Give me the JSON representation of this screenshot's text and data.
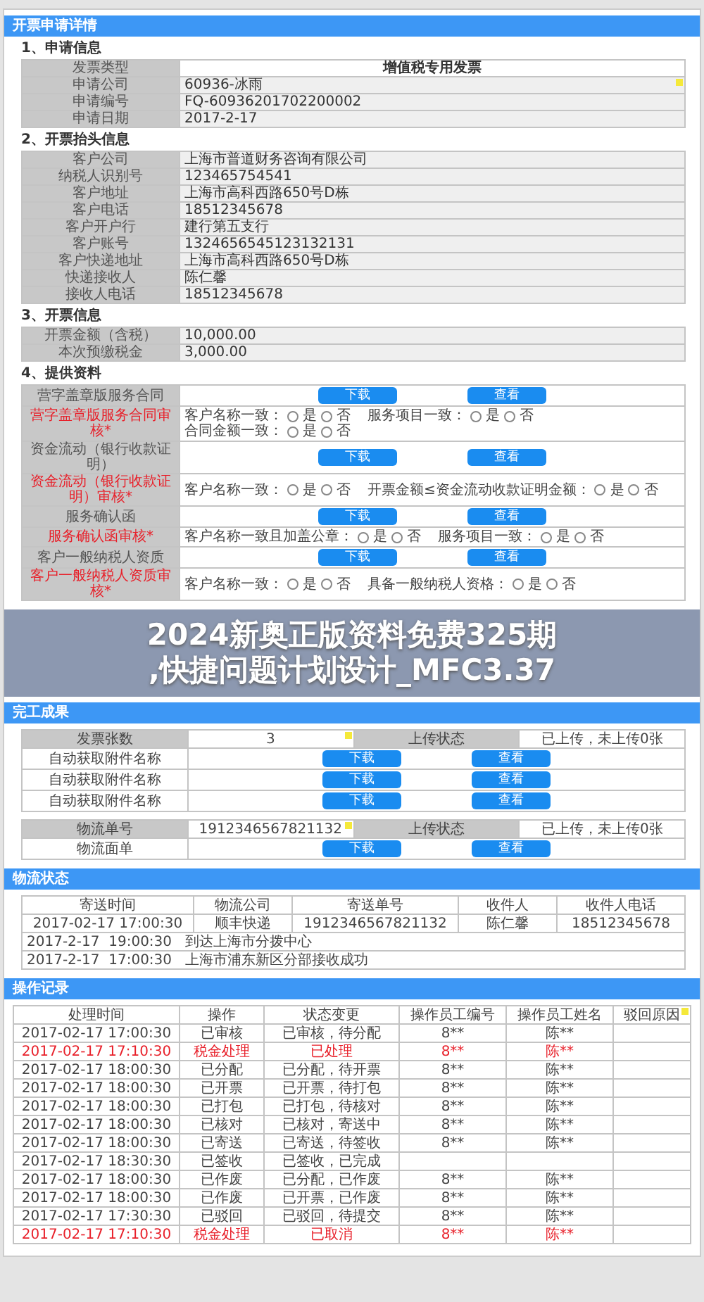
{
  "application": {
    "title": "开票申请详情",
    "request": {
      "heading": "1、申请信息",
      "rows": [
        {
          "kind": "title",
          "label": "发票类型",
          "value": "增值税专用发票",
          "note": false
        },
        {
          "kind": "field",
          "label": "申请公司",
          "value": "60936-冰雨",
          "note": true
        },
        {
          "kind": "field",
          "label": "申请编号",
          "value": "FQ-60936201702200002",
          "note": false
        },
        {
          "kind": "field",
          "label": "申请日期",
          "value": "2017-2-17",
          "note": false
        }
      ]
    },
    "header_info": {
      "heading": "2、开票抬头信息",
      "rows": [
        {
          "kind": "field",
          "label": "客户公司",
          "value": "上海市普道财务咨询有限公司"
        },
        {
          "kind": "field",
          "label": "纳税人识别号",
          "value": "123465754541"
        },
        {
          "kind": "field",
          "label": "客户地址",
          "value": "上海市高科西路650号D栋"
        },
        {
          "kind": "field",
          "label": "客户电话",
          "value": "18512345678"
        },
        {
          "kind": "field",
          "label": "客户开户行",
          "value": "建行第五支行"
        },
        {
          "kind": "field",
          "label": "客户账号",
          "value": "1324656545123132131"
        },
        {
          "kind": "field",
          "label": "客户快递地址",
          "value": "上海市高科西路650号D栋"
        },
        {
          "kind": "field",
          "label": "快递接收人",
          "value": "陈仁馨"
        },
        {
          "kind": "field",
          "label": "接收人电话",
          "value": "18512345678"
        }
      ]
    },
    "invoice_info": {
      "heading": "3、开票信息",
      "rows": [
        {
          "kind": "field",
          "label": "开票金额（含税）",
          "value": "10,000.00"
        },
        {
          "kind": "field",
          "label": "本次预缴税金",
          "value": "3,000.00"
        }
      ]
    },
    "materials": {
      "heading": "4、提供资料",
      "rows": [
        {
          "kind": "file",
          "label": "营字盖章版服务合同",
          "buttons": [
            "下载",
            "查看"
          ]
        },
        {
          "kind": "review",
          "label": "营字盖章版服务合同审核*",
          "questions": [
            {
              "label": "客户名称一致：",
              "options": [
                {
                  "label": "是",
                  "selected": false
                },
                {
                  "label": "否",
                  "selected": false
                }
              ]
            },
            {
              "label": "服务项目一致：",
              "options": [
                {
                  "label": "是",
                  "selected": false
                },
                {
                  "label": "否",
                  "selected": false
                }
              ]
            },
            {
              "label": "合同金额一致：",
              "options": [
                {
                  "label": "是",
                  "selected": false
                },
                {
                  "label": "否",
                  "selected": false
                }
              ]
            }
          ]
        },
        {
          "kind": "file",
          "label": "资金流动（银行收款证明）",
          "buttons": [
            "下载",
            "查看"
          ]
        },
        {
          "kind": "review",
          "label": "资金流动（银行收款证明）审核*",
          "questions": [
            {
              "label": "客户名称一致：",
              "options": [
                {
                  "label": "是",
                  "selected": false
                },
                {
                  "label": "否",
                  "selected": false
                }
              ]
            },
            {
              "label": "开票金额≤资金流动收款证明金额：",
              "options": [
                {
                  "label": "是",
                  "selected": false
                },
                {
                  "label": "否",
                  "selected": false
                }
              ]
            }
          ]
        },
        {
          "kind": "file",
          "label": "服务确认函",
          "buttons": [
            "下载",
            "查看"
          ]
        },
        {
          "kind": "review",
          "label": "服务确认函审核*",
          "questions": [
            {
              "label": "客户名称一致且加盖公章：",
              "options": [
                {
                  "label": "是",
                  "selected": false
                },
                {
                  "label": "否",
                  "selected": false
                }
              ]
            },
            {
              "label": "服务项目一致：",
              "options": [
                {
                  "label": "是",
                  "selected": false
                },
                {
                  "label": "否",
                  "selected": false
                }
              ]
            }
          ]
        },
        {
          "kind": "file",
          "label": "客户一般纳税人资质",
          "buttons": [
            "下载",
            "查看"
          ]
        },
        {
          "kind": "review",
          "label": "客户一般纳税人资质审核*",
          "questions": [
            {
              "label": "客户名称一致：",
              "options": [
                {
                  "label": "是",
                  "selected": false
                },
                {
                  "label": "否",
                  "selected": false
                }
              ]
            },
            {
              "label": "具备一般纳税人资格：",
              "options": [
                {
                  "label": "是",
                  "selected": false
                },
                {
                  "label": "否",
                  "selected": false
                }
              ]
            }
          ]
        }
      ]
    }
  },
  "banner": {
    "lines": [
      "2024新奥正版资料免费325期",
      ",快捷问题计划设计_MFC3.37"
    ]
  },
  "completion": {
    "title": "完工成果",
    "tables": [
      {
        "head": [
          "发票张数",
          "3",
          "上传状态",
          "已上传，未上传0张"
        ],
        "note": true,
        "rows": [
          {
            "label": "自动获取附件名称",
            "buttons": [
              "下载",
              "查看"
            ]
          },
          {
            "label": "自动获取附件名称",
            "buttons": [
              "下载",
              "查看"
            ]
          },
          {
            "label": "自动获取附件名称",
            "buttons": [
              "下载",
              "查看"
            ]
          }
        ]
      },
      {
        "head": [
          "物流单号",
          "1912346567821132",
          "上传状态",
          "已上传，未上传0张"
        ],
        "note": true,
        "rows": [
          {
            "label": "物流面单",
            "buttons": [
              "下载",
              "查看"
            ]
          }
        ]
      }
    ]
  },
  "logistics": {
    "title": "物流状态",
    "columns": [
      "寄送时间",
      "物流公司",
      "寄送单号",
      "收件人",
      "收件人电话"
    ],
    "row": [
      "2017-02-17 17:00:30",
      "顺丰快递",
      "1912346567821132",
      "陈仁馨",
      "18512345678"
    ],
    "events": [
      {
        "time": "2017-2-17  19:00:30",
        "text": "到达上海市分拨中心"
      },
      {
        "time": "2017-2-17  17:00:30",
        "text": "上海市浦东新区分部接收成功"
      }
    ]
  },
  "operations": {
    "title": "操作记录",
    "columns": [
      "处理时间",
      "操作",
      "状态变更",
      "操作员工编号",
      "操作员工姓名",
      "驳回原因"
    ],
    "rows": [
      {
        "highlighted": false,
        "cells": [
          "2017-02-17 17:00:30",
          "已审核",
          "已审核，待分配",
          "8**",
          "陈**"
        ]
      },
      {
        "highlighted": true,
        "cells": [
          "2017-02-17 17:10:30",
          "税金处理",
          "已处理",
          "8**",
          "陈**"
        ]
      },
      {
        "highlighted": false,
        "cells": [
          "2017-02-17 18:00:30",
          "已分配",
          "已分配，待开票",
          "8**",
          "陈**"
        ]
      },
      {
        "highlighted": false,
        "cells": [
          "2017-02-17 18:00:30",
          "已开票",
          "已开票，待打包",
          "8**",
          "陈**"
        ]
      },
      {
        "highlighted": false,
        "cells": [
          "2017-02-17 18:00:30",
          "已打包",
          "已打包，待核对",
          "8**",
          "陈**"
        ]
      },
      {
        "highlighted": false,
        "cells": [
          "2017-02-17 18:00:30",
          "已核对",
          "已核对，寄送中",
          "8**",
          "陈**"
        ]
      },
      {
        "highlighted": false,
        "cells": [
          "2017-02-17 18:00:30",
          "已寄送",
          "已寄送，待签收",
          "8**",
          "陈**"
        ]
      },
      {
        "highlighted": false,
        "cells": [
          "2017-02-17 18:30:30",
          "已签收",
          "已签收，已完成"
        ]
      },
      {
        "highlighted": false,
        "cells": [
          "2017-02-17 18:00:30",
          "已作废",
          "已分配，已作废",
          "8**",
          "陈**"
        ]
      },
      {
        "highlighted": false,
        "cells": [
          "2017-02-17 18:00:30",
          "已作废",
          "已开票，已作废",
          "8**",
          "陈**"
        ]
      },
      {
        "highlighted": false,
        "cells": [
          "2017-02-17 17:30:30",
          "已驳回",
          "已驳回，待提交",
          "8**",
          "陈**"
        ]
      },
      {
        "highlighted": true,
        "cells": [
          "2017-02-17 17:10:30",
          "税金处理",
          "已取消",
          "8**",
          "陈**"
        ]
      }
    ]
  }
}
